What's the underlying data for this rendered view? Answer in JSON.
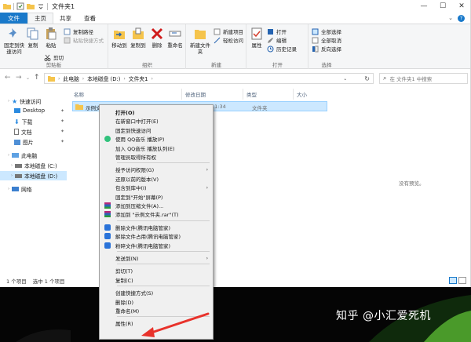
{
  "window": {
    "title": "文件夹1",
    "controls": [
      "—",
      "☐",
      "✕"
    ]
  },
  "tabs": {
    "file": "文件",
    "home": "主页",
    "share": "共享",
    "view": "查看"
  },
  "ribbon": {
    "clipboard": {
      "pin": "固定到快速访问",
      "copy": "复制",
      "paste": "粘贴",
      "copy_path": "复制路径",
      "paste_shortcut": "粘贴快捷方式",
      "cut": "剪切",
      "label": "剪贴板"
    },
    "organize": {
      "move_to": "移动到",
      "copy_to": "复制到",
      "delete": "删除",
      "rename": "重命名",
      "label": "组织"
    },
    "new": {
      "new_folder": "新建文件夹",
      "new_item": "新建项目",
      "easy_access": "轻松访问",
      "label": "新建"
    },
    "open": {
      "properties": "属性",
      "open": "打开",
      "edit": "编辑",
      "history": "历史记录",
      "label": "打开"
    },
    "select": {
      "select_all": "全部选择",
      "select_none": "全部取消",
      "invert": "反向选择",
      "label": "选择"
    }
  },
  "address": {
    "crumbs": [
      "此电脑",
      "本地磁盘 (D:)",
      "文件夹1"
    ],
    "search_placeholder": "在 文件夹1 中搜索"
  },
  "nav": {
    "quick_access": "快速访问",
    "desktop": "Desktop",
    "downloads": "下载",
    "documents": "文档",
    "pictures": "图片",
    "this_pc": "此电脑",
    "drive_c": "本地磁盘 (C:)",
    "drive_d": "本地磁盘 (D:)",
    "network": "网络"
  },
  "columns": {
    "name": "名称",
    "date": "修改日期",
    "type": "类型",
    "size": "大小"
  },
  "row": {
    "name": "示例文",
    "time": "11:34",
    "type": "文件夹"
  },
  "preview": {
    "message": "没有预览。"
  },
  "status": {
    "count": "1 个项目",
    "selected": "选中 1 个项目"
  },
  "context_menu": [
    {
      "label": "打开(O)",
      "bold": true,
      "icon": "",
      "arrow": false
    },
    {
      "label": "在新窗口中打开(E)",
      "icon": "",
      "arrow": false
    },
    {
      "label": "固定到快速访问",
      "icon": "",
      "arrow": false
    },
    {
      "label": "使用 QQ音乐 播放(P)",
      "icon": "qq-music-icon",
      "arrow": false
    },
    {
      "label": "加入 QQ音乐 播放队列(E)",
      "icon": "",
      "arrow": false
    },
    {
      "label": "管理员取得所有权",
      "icon": "",
      "arrow": false
    },
    {
      "sep": true
    },
    {
      "label": "授予访问权限(G)",
      "icon": "",
      "arrow": true
    },
    {
      "label": "还原以前的版本(V)",
      "icon": "",
      "arrow": false
    },
    {
      "label": "包含到库中(I)",
      "icon": "",
      "arrow": true
    },
    {
      "label": "固定到\"开始\"屏幕(P)",
      "icon": "",
      "arrow": false
    },
    {
      "label": "添加到压缩文件(A)...",
      "icon": "winrar-icon",
      "arrow": false
    },
    {
      "label": "添加到 \"示例文件夹.rar\"(T)",
      "icon": "winrar-icon",
      "arrow": false
    },
    {
      "sep": true
    },
    {
      "label": "删除文件(腾讯电脑管家)",
      "icon": "tencent-icon",
      "arrow": false
    },
    {
      "label": "解除文件占用(腾讯电脑管家)",
      "icon": "tencent-icon",
      "arrow": false
    },
    {
      "label": "粉碎文件(腾讯电脑管家)",
      "icon": "tencent-icon",
      "arrow": false
    },
    {
      "sep": true
    },
    {
      "label": "发送到(N)",
      "icon": "",
      "arrow": true
    },
    {
      "sep": true
    },
    {
      "label": "剪切(T)",
      "icon": "",
      "arrow": false
    },
    {
      "label": "复制(C)",
      "icon": "",
      "arrow": false
    },
    {
      "sep": true
    },
    {
      "label": "创建快捷方式(S)",
      "icon": "",
      "arrow": false
    },
    {
      "label": "删除(D)",
      "icon": "",
      "arrow": false
    },
    {
      "label": "重命名(M)",
      "icon": "",
      "arrow": false
    },
    {
      "sep": true
    },
    {
      "label": "属性(R)",
      "icon": "",
      "arrow": false
    }
  ],
  "watermark": "知乎 @小汇爱死机",
  "colors": {
    "accent": "#1979ca",
    "selection": "#cce8ff",
    "arrow": "#e8322b"
  }
}
